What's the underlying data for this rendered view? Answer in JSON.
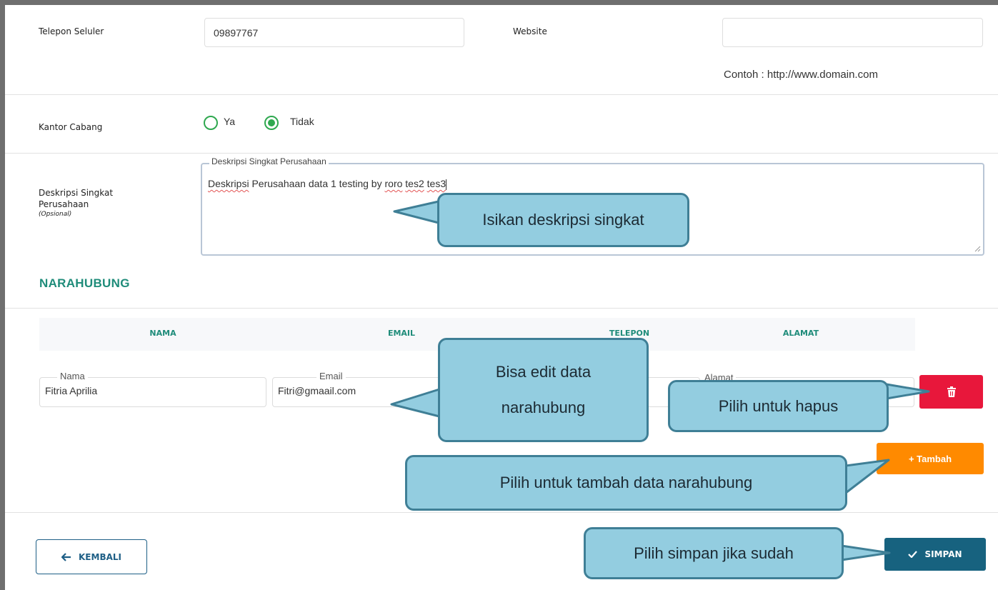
{
  "form": {
    "phone_label": "Telepon Seluler",
    "phone_value": "09897767",
    "website_label": "Website",
    "website_value": "",
    "website_hint": "Contoh : http://www.domain.com",
    "branch_label": "Kantor Cabang",
    "branch_options": [
      "Ya",
      "Tidak"
    ],
    "branch_selected": "Tidak",
    "desc_label_line1": "Deskripsi Singkat",
    "desc_label_line2": "Perusahaan",
    "desc_optional": "(Opsional)",
    "desc_legend": "Deskripsi Singkat Perusahaan",
    "desc_value_parts": [
      "Deskripsi",
      " Perusahaan data 1 testing by ",
      "roro",
      " ",
      "tes2",
      " ",
      "tes3"
    ]
  },
  "contacts": {
    "section_title": "NARAHUBUNG",
    "columns": [
      "NAMA",
      "EMAIL",
      "TELEPON",
      "ALAMAT"
    ],
    "row": {
      "nama_label": "Nama",
      "nama_value": "Fitria Aprilia",
      "email_label": "Email",
      "email_value": "Fitri@gmaail.com",
      "alamat_label": "Alamat"
    },
    "delete_icon": "trash-icon",
    "add_label": "+ Tambah"
  },
  "footer": {
    "back_label": "KEMBALI",
    "back_icon": "arrow-left-icon",
    "save_label": "SIMPAN",
    "save_icon": "check-icon"
  },
  "callouts": {
    "desc": "Isikan deskripsi singkat",
    "edit_line1": "Bisa edit data",
    "edit_line2": "narahubung",
    "delete": "Pilih untuk hapus",
    "add": "Pilih untuk tambah data narahubung",
    "save": "Pilih simpan jika sudah"
  },
  "colors": {
    "accent_green": "#1f8c7a",
    "radio_green": "#2fa84f",
    "delete_red": "#e8173b",
    "add_orange": "#ff8a00",
    "save_blue": "#17627f",
    "callout_fill": "#93cde0",
    "callout_border": "#3f7f96"
  }
}
